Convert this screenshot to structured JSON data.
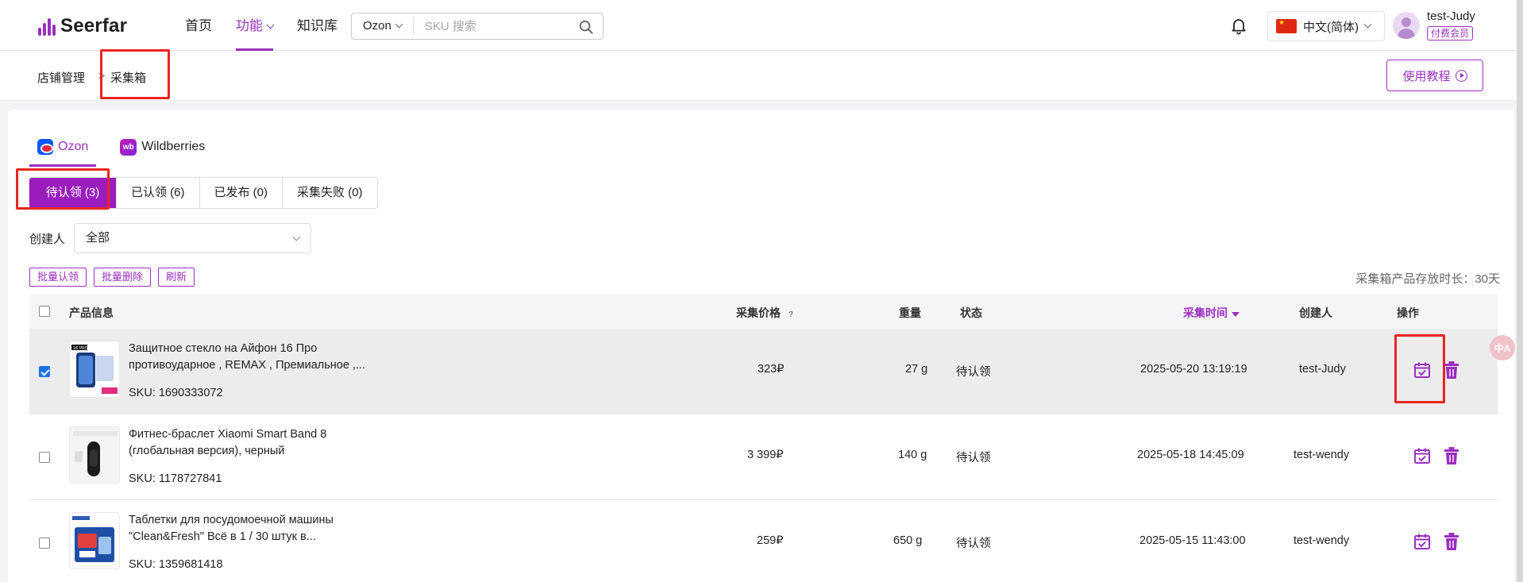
{
  "header": {
    "logo": "Seerfar",
    "nav": [
      {
        "label": "首页",
        "active": false
      },
      {
        "label": "功能",
        "active": true,
        "dropdown": true
      },
      {
        "label": "知识库",
        "active": false
      }
    ],
    "search": {
      "platform": "Ozon",
      "placeholder": "SKU 搜索"
    },
    "language": "中文(简体)",
    "user": {
      "name": "test-Judy",
      "badge": "付费会员"
    }
  },
  "breadcrumb": {
    "parent": "店铺管理",
    "separator": ">",
    "current": "采集箱",
    "tutorial_label": "使用教程"
  },
  "platform_tabs": [
    {
      "label": "Ozon",
      "active": true
    },
    {
      "label": "Wildberries",
      "active": false
    }
  ],
  "status_tabs": [
    {
      "label": "待认领 (3)",
      "active": true
    },
    {
      "label": "已认领 (6)",
      "active": false
    },
    {
      "label": "已发布 (0)",
      "active": false
    },
    {
      "label": "采集失败 (0)",
      "active": false
    }
  ],
  "filter": {
    "creator_label": "创建人",
    "creator_value": "全部"
  },
  "bulk_actions": [
    "批量认领",
    "批量删除",
    "刷新"
  ],
  "storage_note": "采集箱产品存放时长：30天",
  "table": {
    "headers": {
      "product": "产品信息",
      "price": "采集价格",
      "price_help": "?",
      "weight": "重量",
      "status": "状态",
      "time": "采集时间",
      "creator": "创建人",
      "actions": "操作"
    },
    "rows": [
      {
        "title": "Защитное стекло на Айфон 16 Про противоударное , REMAX , Премиальное ,...",
        "sku": "SKU: 1690333072",
        "price": "323₽",
        "weight": "27 g",
        "status": "待认领",
        "time": "2025-05-20 13:19:19",
        "creator": "test-Judy",
        "checked": true
      },
      {
        "title": "Фитнес-браслет Xiaomi Smart Band 8 (глобальная версия), черный",
        "sku": "SKU: 1178727841",
        "price": "3 399₽",
        "weight": "140 g",
        "status": "待认领",
        "time": "2025-05-18 14:45:09",
        "creator": "test-wendy",
        "checked": false
      },
      {
        "title": "Таблетки для посудомоечной машины \"Clean&Fresh\" Всё в 1 / 30 штук в...",
        "sku": "SKU: 1359681418",
        "price": "259₽",
        "weight": "650 g",
        "status": "待认领",
        "time": "2025-05-15 11:43:00",
        "creator": "test-wendy",
        "checked": false
      }
    ]
  },
  "colors": {
    "brand": "#9b2fbf",
    "highlight": "#e9251f"
  },
  "floating_widget": "中A"
}
